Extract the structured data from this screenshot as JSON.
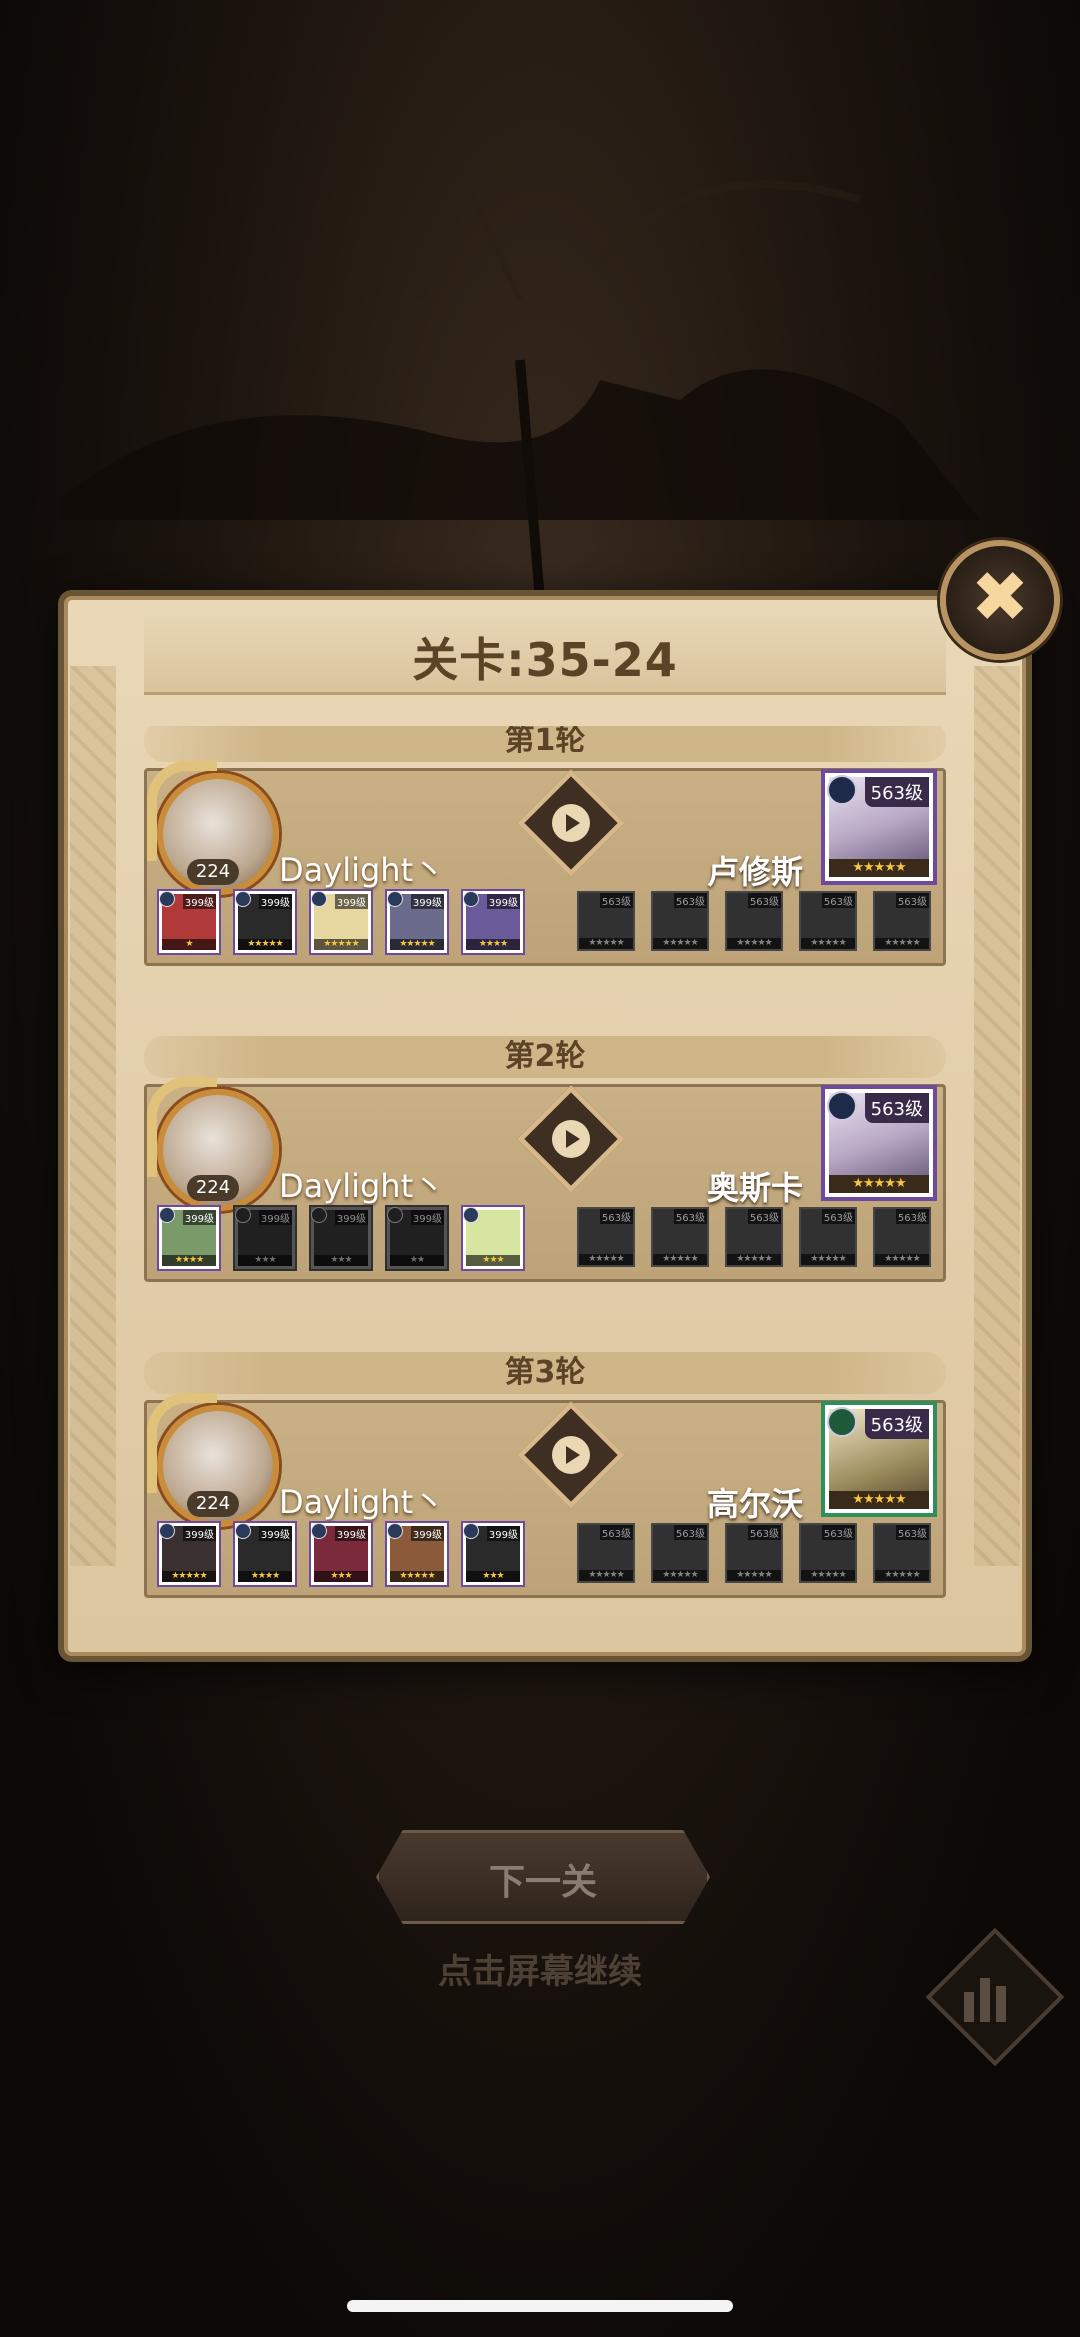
{
  "title": "关卡:35-24",
  "close_icon": "close-icon",
  "rounds": [
    {
      "label": "第1轮",
      "player": {
        "name": "Daylight丶",
        "level": "224"
      },
      "player_heroes": [
        {
          "level": "399级",
          "stars": "★",
          "tint": "#b03a3a"
        },
        {
          "level": "399级",
          "stars": "★★★★★",
          "tint": "#2a2a2a"
        },
        {
          "level": "399级",
          "stars": "★★★★★",
          "tint": "#e6d6a0"
        },
        {
          "level": "399级",
          "stars": "★★★★★",
          "tint": "#6a6a8a"
        },
        {
          "level": "399级",
          "stars": "★★★★",
          "tint": "#6a5a9a"
        }
      ],
      "enemy": {
        "name": "卢修斯",
        "level": "563级",
        "stars": "★★★★★"
      },
      "enemy_heroes": [
        {
          "level": "563级",
          "stars": "★★★★★"
        },
        {
          "level": "563级",
          "stars": "★★★★★"
        },
        {
          "level": "563级",
          "stars": "★★★★★"
        },
        {
          "level": "563级",
          "stars": "★★★★★"
        },
        {
          "level": "563级",
          "stars": "★★★★★"
        }
      ]
    },
    {
      "label": "第2轮",
      "player": {
        "name": "Daylight丶",
        "level": "224"
      },
      "player_heroes": [
        {
          "level": "399级",
          "stars": "★★★★",
          "tint": "#7a9a6a"
        },
        {
          "level": "399级",
          "stars": "★★★",
          "tint": "#3a3a3a",
          "gray": true
        },
        {
          "level": "399级",
          "stars": "★★★",
          "tint": "#3a3a3a",
          "gray": true
        },
        {
          "level": "399级",
          "stars": "★★",
          "tint": "#3a3a3a",
          "gray": true
        },
        {
          "level": "",
          "stars": "★★★",
          "tint": "#d6e6a0"
        }
      ],
      "enemy": {
        "name": "奥斯卡",
        "level": "563级",
        "stars": "★★★★★"
      },
      "enemy_heroes": [
        {
          "level": "563级",
          "stars": "★★★★★"
        },
        {
          "level": "563级",
          "stars": "★★★★★"
        },
        {
          "level": "563级",
          "stars": "★★★★★"
        },
        {
          "level": "563级",
          "stars": "★★★★★"
        },
        {
          "level": "563级",
          "stars": "★★★★★"
        }
      ]
    },
    {
      "label": "第3轮",
      "player": {
        "name": "Daylight丶",
        "level": "224"
      },
      "player_heroes": [
        {
          "level": "399级",
          "stars": "★★★★★",
          "tint": "#3a3030"
        },
        {
          "level": "399级",
          "stars": "★★★★",
          "tint": "#2a2a2a"
        },
        {
          "level": "399级",
          "stars": "★★★",
          "tint": "#7a2a3a"
        },
        {
          "level": "399级",
          "stars": "★★★★★",
          "tint": "#8a5a3a"
        },
        {
          "level": "399级",
          "stars": "★★★",
          "tint": "#2a2a2a"
        }
      ],
      "enemy": {
        "name": "高尔沃",
        "level": "563级",
        "stars": "★★★★★"
      },
      "enemy_heroes": [
        {
          "level": "563级",
          "stars": "★★★★★"
        },
        {
          "level": "563级",
          "stars": "★★★★★"
        },
        {
          "level": "563级",
          "stars": "★★★★★"
        },
        {
          "level": "563级",
          "stars": "★★★★★"
        },
        {
          "level": "563级",
          "stars": "★★★★★"
        }
      ]
    }
  ],
  "next_button": "下一关",
  "hint": "点击屏幕继续",
  "stats_icon": "stats-icon"
}
